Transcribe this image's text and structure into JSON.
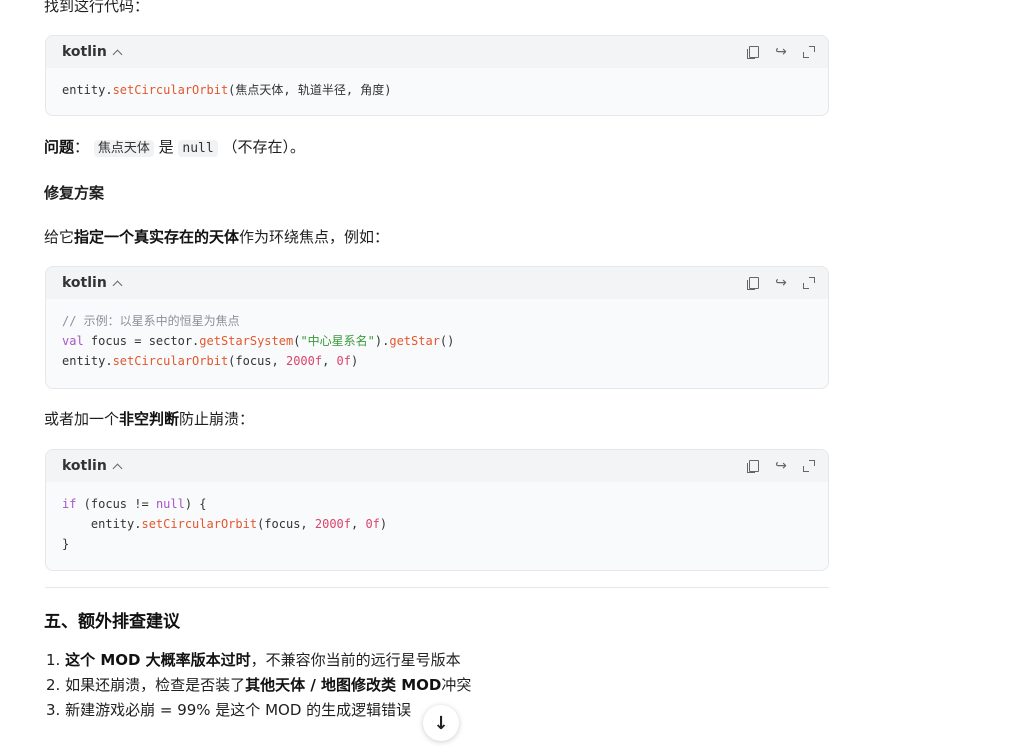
{
  "intro_line": "找到这行代码：",
  "code1": {
    "lang": "kotlin",
    "line1_a": "entity.",
    "line1_fn": "setCircularOrbit",
    "line1_b": "(焦点天体, 轨道半径, 角度)"
  },
  "problem": {
    "label": "问题",
    "colon": "：",
    "code_a": "焦点天体",
    "is": " 是 ",
    "code_b": "null",
    "tail": "（不存在）。"
  },
  "fix_heading": "修复方案",
  "fix_text": {
    "pre": "给它",
    "bold": "指定一个真实存在的天体",
    "post": "作为环绕焦点，例如："
  },
  "code2": {
    "lang": "kotlin",
    "comment": "// 示例：以星系中的恒星为焦点",
    "l2_kw": "val",
    "l2_a": " focus = sector.",
    "l2_fn1": "getStarSystem",
    "l2_b": "(",
    "l2_str": "\"中心星系名\"",
    "l2_c": ").",
    "l2_fn2": "getStar",
    "l2_d": "()",
    "l3_a": "entity.",
    "l3_fn": "setCircularOrbit",
    "l3_b": "(focus, ",
    "l3_n1": "2000f",
    "l3_c": ", ",
    "l3_n2": "0f",
    "l3_d": ")"
  },
  "alt_text": {
    "pre": "或者加一个",
    "bold": "非空判断",
    "post": "防止崩溃："
  },
  "code3": {
    "lang": "kotlin",
    "l1_kw": "if",
    "l1_a": " (focus != ",
    "l1_kw2": "null",
    "l1_b": ") {",
    "l2_a": "    entity.",
    "l2_fn": "setCircularOrbit",
    "l2_b": "(focus, ",
    "l2_n1": "2000f",
    "l2_c": ", ",
    "l2_n2": "0f",
    "l2_d": ")",
    "l3": "}"
  },
  "section5_title": "五、额外排查建议",
  "list": [
    {
      "num": "1.",
      "bold": "这个 MOD 大概率版本过时",
      "post": "，不兼容你当前的远行星号版本"
    },
    {
      "num": "2.",
      "pre": "如果还崩溃，检查是否装了",
      "bold": "其他天体 / 地图修改类 MOD",
      "post": "冲突"
    },
    {
      "num": "3.",
      "pre": "新建游戏必崩 = 99% 是这个 MOD 的生成逻辑错误"
    }
  ],
  "scroll_icon": "arrow-down-icon",
  "scroll_glyph": "↓"
}
